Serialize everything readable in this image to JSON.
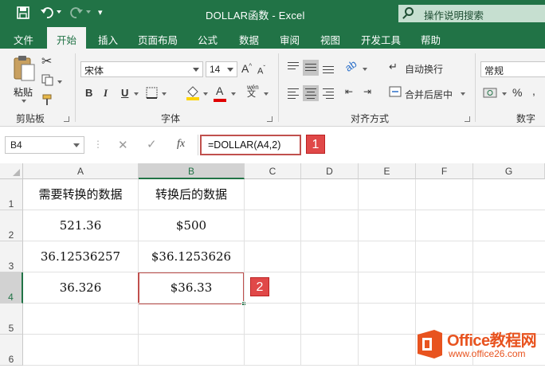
{
  "window": {
    "title": "DOLLAR函数  -  Excel"
  },
  "tell_me": {
    "placeholder": "操作说明搜索"
  },
  "tabs": [
    {
      "label": "文件"
    },
    {
      "label": "开始"
    },
    {
      "label": "插入"
    },
    {
      "label": "页面布局"
    },
    {
      "label": "公式"
    },
    {
      "label": "数据"
    },
    {
      "label": "审阅"
    },
    {
      "label": "视图"
    },
    {
      "label": "开发工具"
    },
    {
      "label": "帮助"
    }
  ],
  "ribbon": {
    "clipboard": {
      "paste_label": "粘贴",
      "group_label": "剪贴板"
    },
    "font": {
      "name": "宋体",
      "size": "14",
      "group_label": "字体",
      "bold": "B",
      "italic": "I",
      "underline": "U",
      "font_color_glyph": "A",
      "phonetic": "wén"
    },
    "alignment": {
      "wrap_text": "自动换行",
      "merge_center": "合并后居中",
      "group_label": "对齐方式"
    },
    "number": {
      "format": "常规",
      "percent": "%",
      "group_label": "数字"
    }
  },
  "formula_bar": {
    "name_box": "B4",
    "fx": "fx",
    "formula": "=DOLLAR(A4,2)"
  },
  "callouts": {
    "one": "1",
    "two": "2"
  },
  "sheet": {
    "columns": [
      "A",
      "B",
      "C",
      "D",
      "E",
      "F",
      "G"
    ],
    "rows": [
      "1",
      "2",
      "3",
      "4",
      "5",
      "6"
    ],
    "cells": {
      "A1": "需要转换的数据",
      "B1": "转换后的数据",
      "A2": "521.36",
      "B2": "$500",
      "A3": "36.12536257",
      "B3": "$36.1253626",
      "A4": "36.326",
      "B4": "$36.33"
    }
  },
  "watermark": {
    "brand": "Office教程网",
    "url": "www.office26.com"
  },
  "colors": {
    "excel_green": "#217346",
    "callout_red": "#e04848",
    "watermark_orange": "#e8531f"
  }
}
